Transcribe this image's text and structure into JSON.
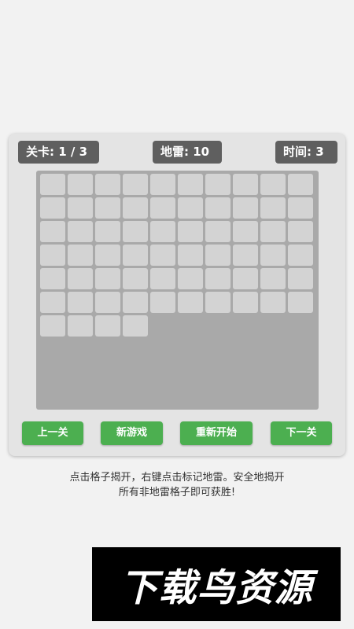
{
  "header": {
    "level": "关卡: 1 / 3",
    "mines": "地雷: 10",
    "time": "时间: 3"
  },
  "board": {
    "columns": 10,
    "cell_count": 64,
    "cell_state": "unrevealed",
    "colors": {
      "cell": "#d3d3d3",
      "background": "#a9a9a9"
    }
  },
  "buttons": {
    "prev": "上一关",
    "new_game": "新游戏",
    "restart": "重新开始",
    "next": "下一关",
    "color": "#4caf50"
  },
  "instructions": {
    "line1": "点击格子揭开，右键点击标记地雷。安全地揭开",
    "line2": "所有非地雷格子即可获胜!"
  },
  "watermark": {
    "text": "下载鸟资源"
  }
}
